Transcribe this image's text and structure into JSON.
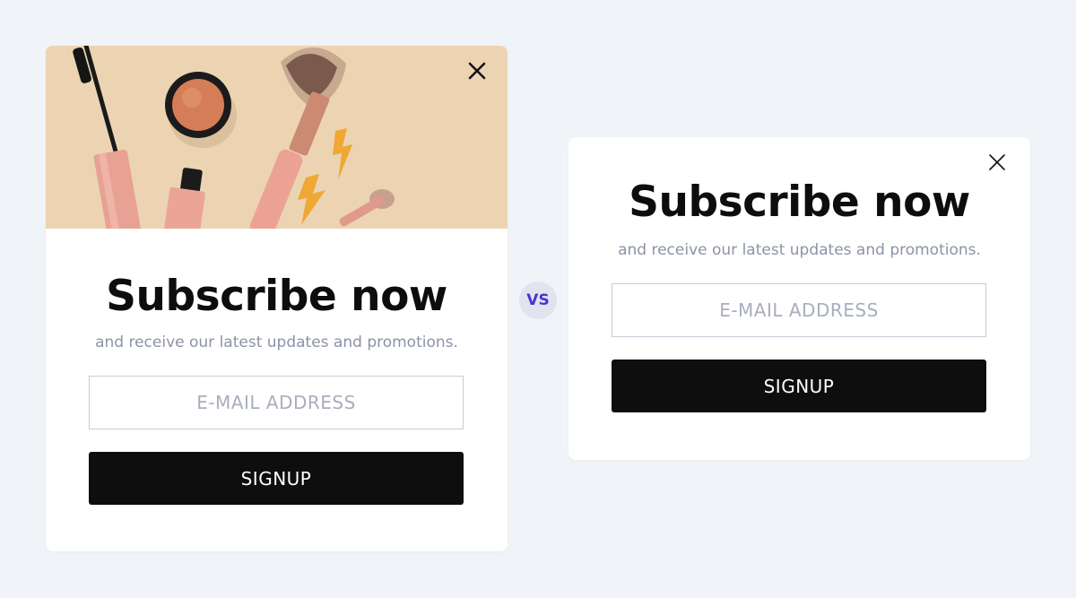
{
  "comparison": {
    "vs_label": "VS"
  },
  "popup_with_image": {
    "title": "Subscribe now",
    "subtitle": "and receive our latest updates and promotions.",
    "email_placeholder": "E-MAIL ADDRESS",
    "signup_label": "SIGNUP",
    "hero_background": "#ecd4b3"
  },
  "popup_text_only": {
    "title": "Subscribe now",
    "subtitle": "and receive our latest updates and promotions.",
    "email_placeholder": "E-MAIL ADDRESS",
    "signup_label": "SIGNUP"
  },
  "colors": {
    "page_background": "#f0f3f7",
    "button": "#0e0e0f",
    "vs_text": "#4b35c8",
    "vs_badge": "#e1e3ee"
  }
}
